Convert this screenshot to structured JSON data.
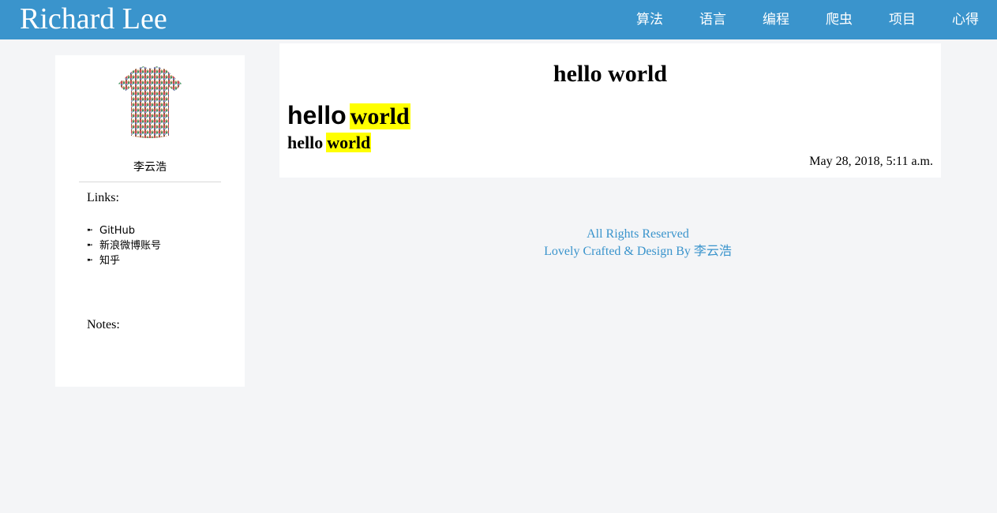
{
  "header": {
    "brand": "Richard Lee",
    "nav": [
      "算法",
      "语言",
      "编程",
      "爬虫",
      "项目",
      "心得"
    ],
    "bg_color": "#3a94cc"
  },
  "sidebar": {
    "author": "李云浩",
    "links_heading": "Links:",
    "links": [
      "GitHub",
      "新浪微博账号",
      "知乎"
    ],
    "notes_heading": "Notes:"
  },
  "post": {
    "title": "hello world",
    "heading1": {
      "plain": "hello",
      "highlight": "world"
    },
    "heading2": {
      "plain": "hello",
      "highlight": "world"
    },
    "date": "May 28, 2018, 5:11 a.m.",
    "highlight_color": "#ffff00"
  },
  "footer": {
    "line1": "All Rights Reserved",
    "line2": "Lovely Crafted & Design By 李云浩"
  }
}
